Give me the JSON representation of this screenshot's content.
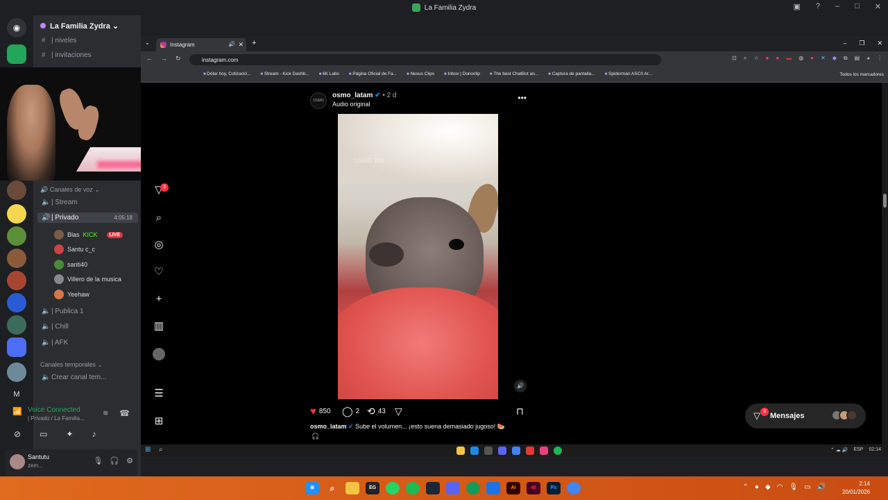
{
  "discord": {
    "window_title": "La Familia Zydra",
    "guild_name": "La Familia Zydra",
    "text_channels": [
      {
        "label": "| niveles"
      },
      {
        "label": "| invitaciones"
      }
    ],
    "voice_category": "Canales de voz",
    "voice_channels": [
      {
        "label": "| Stream"
      },
      {
        "label": "| Privado",
        "timer": "4:05:18"
      },
      {
        "label": "| Publica 1"
      },
      {
        "label": "| Chill"
      },
      {
        "label": "| AFK"
      }
    ],
    "private_users": [
      {
        "name": "Blas",
        "extra": "KICK",
        "badge": "LIVE"
      },
      {
        "name": "Santu c_c"
      },
      {
        "name": "santi40"
      },
      {
        "name": "Villero de la musica"
      },
      {
        "name": "Yeehaw"
      }
    ],
    "temp_category": "Canales temporales",
    "temp_channel": "Crear canal tem...",
    "voice_connected": "Voice Connected",
    "voice_connected_sub": "| Privado / La Familia...",
    "user": {
      "name": "Santutu",
      "status": "zem..."
    },
    "rail_letter": "M"
  },
  "browser": {
    "tab_title": "Instagram",
    "url": "instagram.com",
    "bookmarks": [
      "Dólar hoy, Cotizació...",
      "Stream - Kick Dashb...",
      "6K Labs",
      "Página Oficial de Fa...",
      "Nexus Clips",
      "Inbox | Donoclip",
      "The best ChatBot an...",
      "Captura de pantalla...",
      "Spiderman ASCII Ar..."
    ],
    "all_bookmarks": "Todos los marcadores"
  },
  "instagram": {
    "badge_count": "3",
    "post": {
      "username": "osmo_latam",
      "time": "• 2 d",
      "audio": "Audio original",
      "watermark": "OSMO 360",
      "likes": "850",
      "comments": "2",
      "reposts": "43",
      "caption_user": "osmo_latam",
      "caption_text": "Sube el volumen... ¡esto suena demasiado jugoso! 🍉"
    },
    "messages_label": "Mensajes",
    "messages_badge": "3"
  },
  "inner_taskbar": {
    "lang": "ESP",
    "time": "02:14"
  },
  "taskbar": {
    "time": "2:14",
    "date": "20/01/2026"
  }
}
